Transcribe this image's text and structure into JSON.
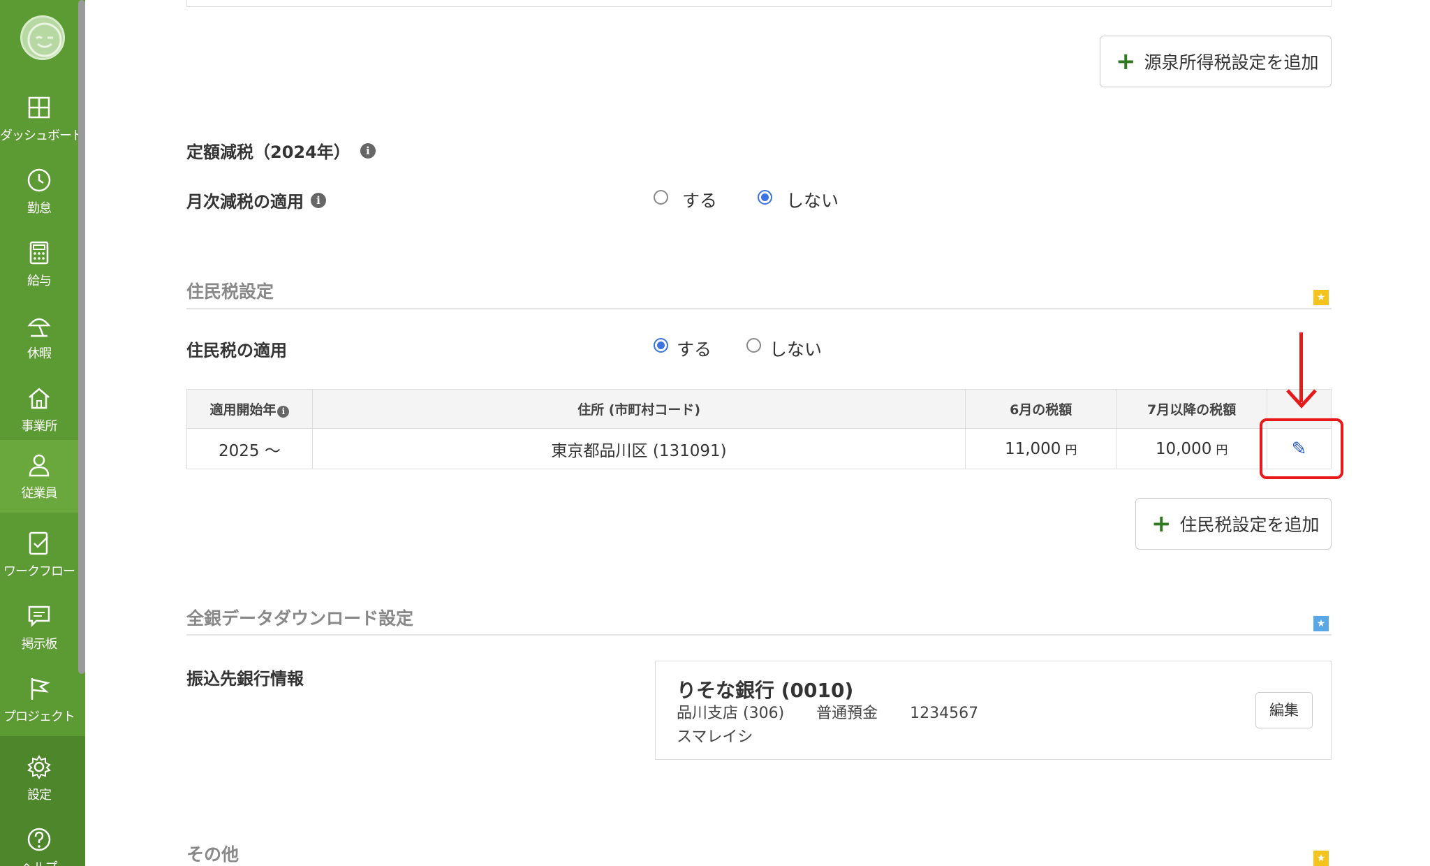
{
  "sidebar": {
    "items": [
      {
        "label": "ダッシュボード",
        "icon": "dashboard-icon"
      },
      {
        "label": "勤怠",
        "icon": "clock-icon"
      },
      {
        "label": "給与",
        "icon": "calculator-icon"
      },
      {
        "label": "休暇",
        "icon": "beach-umbrella-icon"
      },
      {
        "label": "事業所",
        "icon": "home-icon"
      },
      {
        "label": "従業員",
        "icon": "user-icon"
      },
      {
        "label": "ワークフロー",
        "icon": "workflow-icon"
      },
      {
        "label": "掲示板",
        "icon": "message-board-icon"
      },
      {
        "label": "プロジェクト",
        "icon": "flag-icon"
      },
      {
        "label": "設定",
        "icon": "gear-icon"
      },
      {
        "label": "ヘルプ",
        "icon": "help-icon"
      }
    ],
    "active_item": "従業員"
  },
  "withholding": {
    "add_button": "源泉所得税設定を追加"
  },
  "fixed_tax_cut": {
    "title": "定額減税（2024年）",
    "monthly_label": "月次減税の適用",
    "option_yes": "する",
    "option_no": "しない",
    "selected": "しない"
  },
  "resident_tax": {
    "section_title": "住民税設定",
    "apply_label": "住民税の適用",
    "option_yes": "する",
    "option_no": "しない",
    "selected": "する",
    "table": {
      "headers": [
        "適用開始年",
        "住所 (市町村コード)",
        "6月の税額",
        "7月以降の税額"
      ],
      "rows": [
        {
          "start_year": "2025 〜",
          "address": "東京都品川区 (131091)",
          "june_tax": "11,000",
          "after_july_tax": "10,000",
          "currency": "円"
        }
      ]
    },
    "add_button": "住民税設定を追加"
  },
  "bank_download": {
    "section_title": "全銀データダウンロード設定",
    "transfer_label": "振込先銀行情報",
    "bank_name": "りそな銀行 (0010)",
    "branch": "品川支店 (306)",
    "account_type": "普通預金",
    "account_number": "1234567",
    "holder": "スマレイシ",
    "edit_button": "編集"
  },
  "other": {
    "section_title": "その他"
  },
  "colors": {
    "sidebar": "#5c9a34",
    "accent_blue": "#3b73e0",
    "callout_red": "#e8191b",
    "plus_green": "#2f7a1f"
  }
}
